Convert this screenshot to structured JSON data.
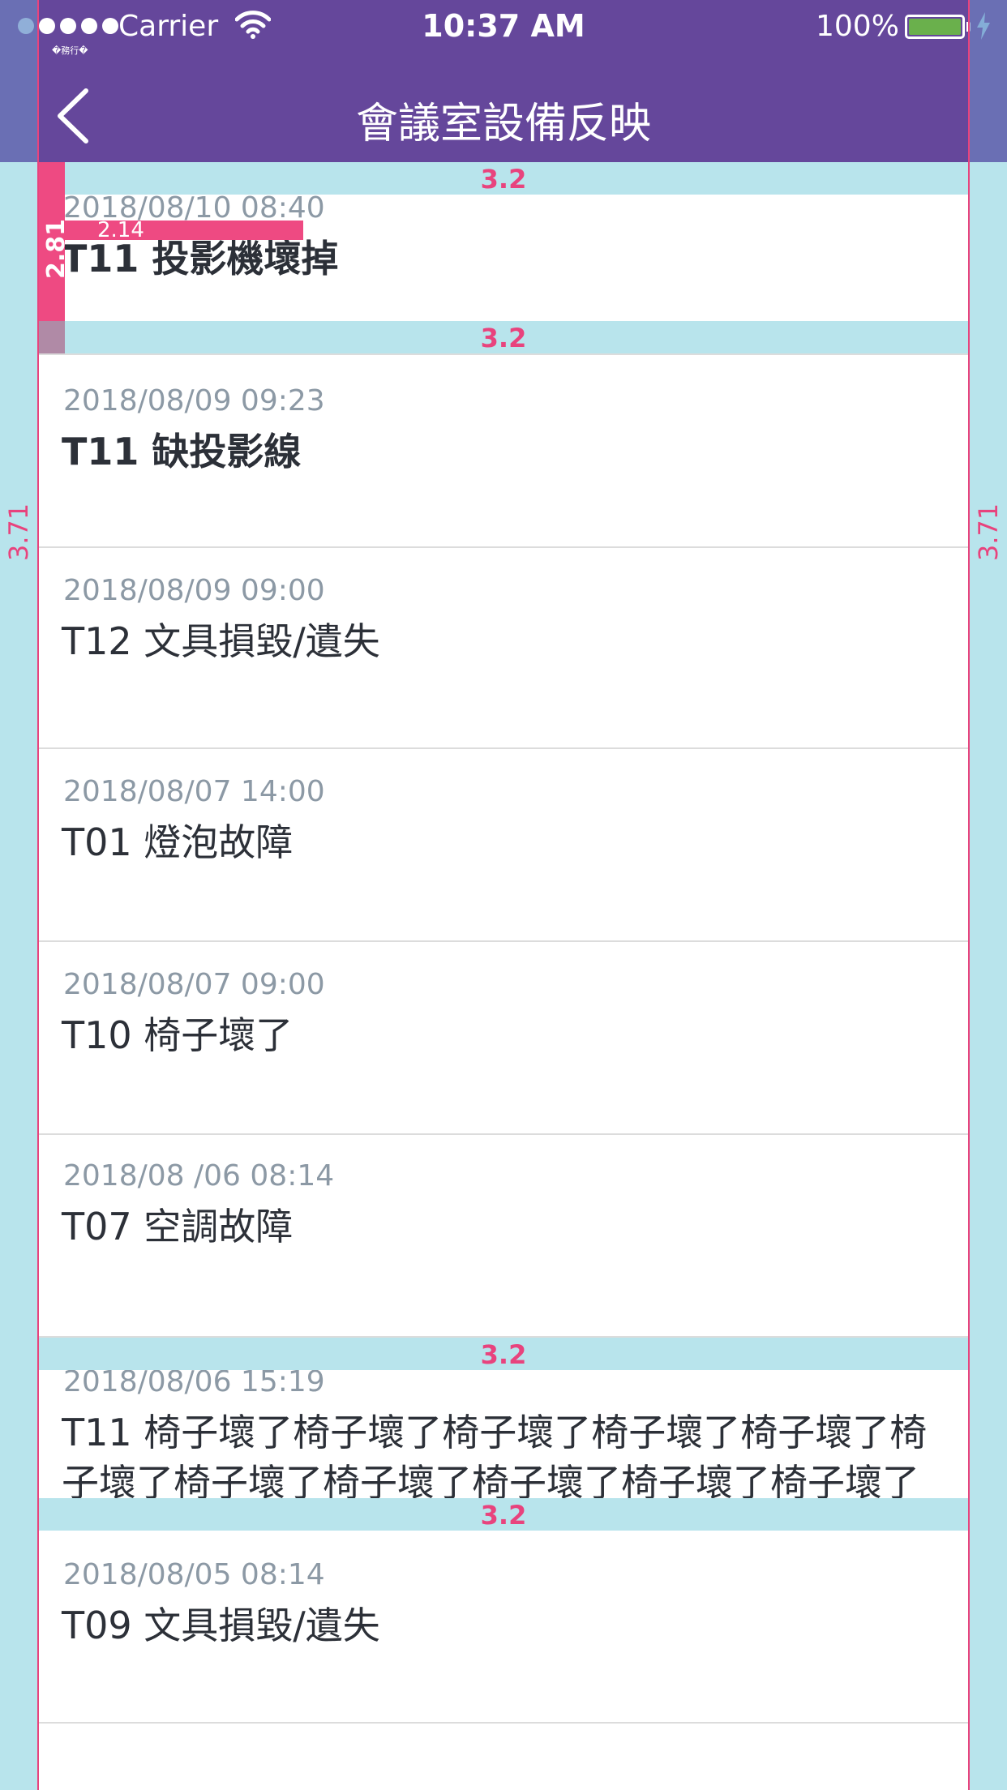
{
  "status_bar": {
    "carrier": "Carrier",
    "time": "10:37 AM",
    "battery": "100%",
    "battery_level": 1.0,
    "signal_bars": 5,
    "small_label": "�務行�"
  },
  "nav": {
    "title": "會議室設備反映",
    "back_icon": "chevron-left-icon"
  },
  "spec": {
    "side_margin": "3.71",
    "band_gap": "3.2",
    "bar_height": "2.81",
    "bar_width": "2.14",
    "colors": {
      "band": "#b8e4ec",
      "marker": "#e8437d",
      "header": "#65479b"
    }
  },
  "items": [
    {
      "date": "2018/08/10 08:40",
      "text": "T11 投影機壞掉"
    },
    {
      "date": "2018/08/09 09:23",
      "text": "T11 缺投影線"
    },
    {
      "date": "2018/08/09 09:00",
      "text": "T12 文具損毀/遺失"
    },
    {
      "date": "2018/08/07 14:00",
      "text": "T01 燈泡故障"
    },
    {
      "date": "2018/08/07 09:00",
      "text": "T10 椅子壞了"
    },
    {
      "date": "2018/08 /06 08:14",
      "text": "T07 空調故障"
    },
    {
      "date": "2018/08/06 15:19",
      "text": "T11 椅子壞了椅子壞了椅子壞了椅子壞了椅子壞了椅子壞了椅子壞了椅子壞了椅子壞了椅子壞了椅子壞了"
    },
    {
      "date": "2018/08/05 08:14",
      "text": "T09 文具損毀/遺失"
    }
  ]
}
